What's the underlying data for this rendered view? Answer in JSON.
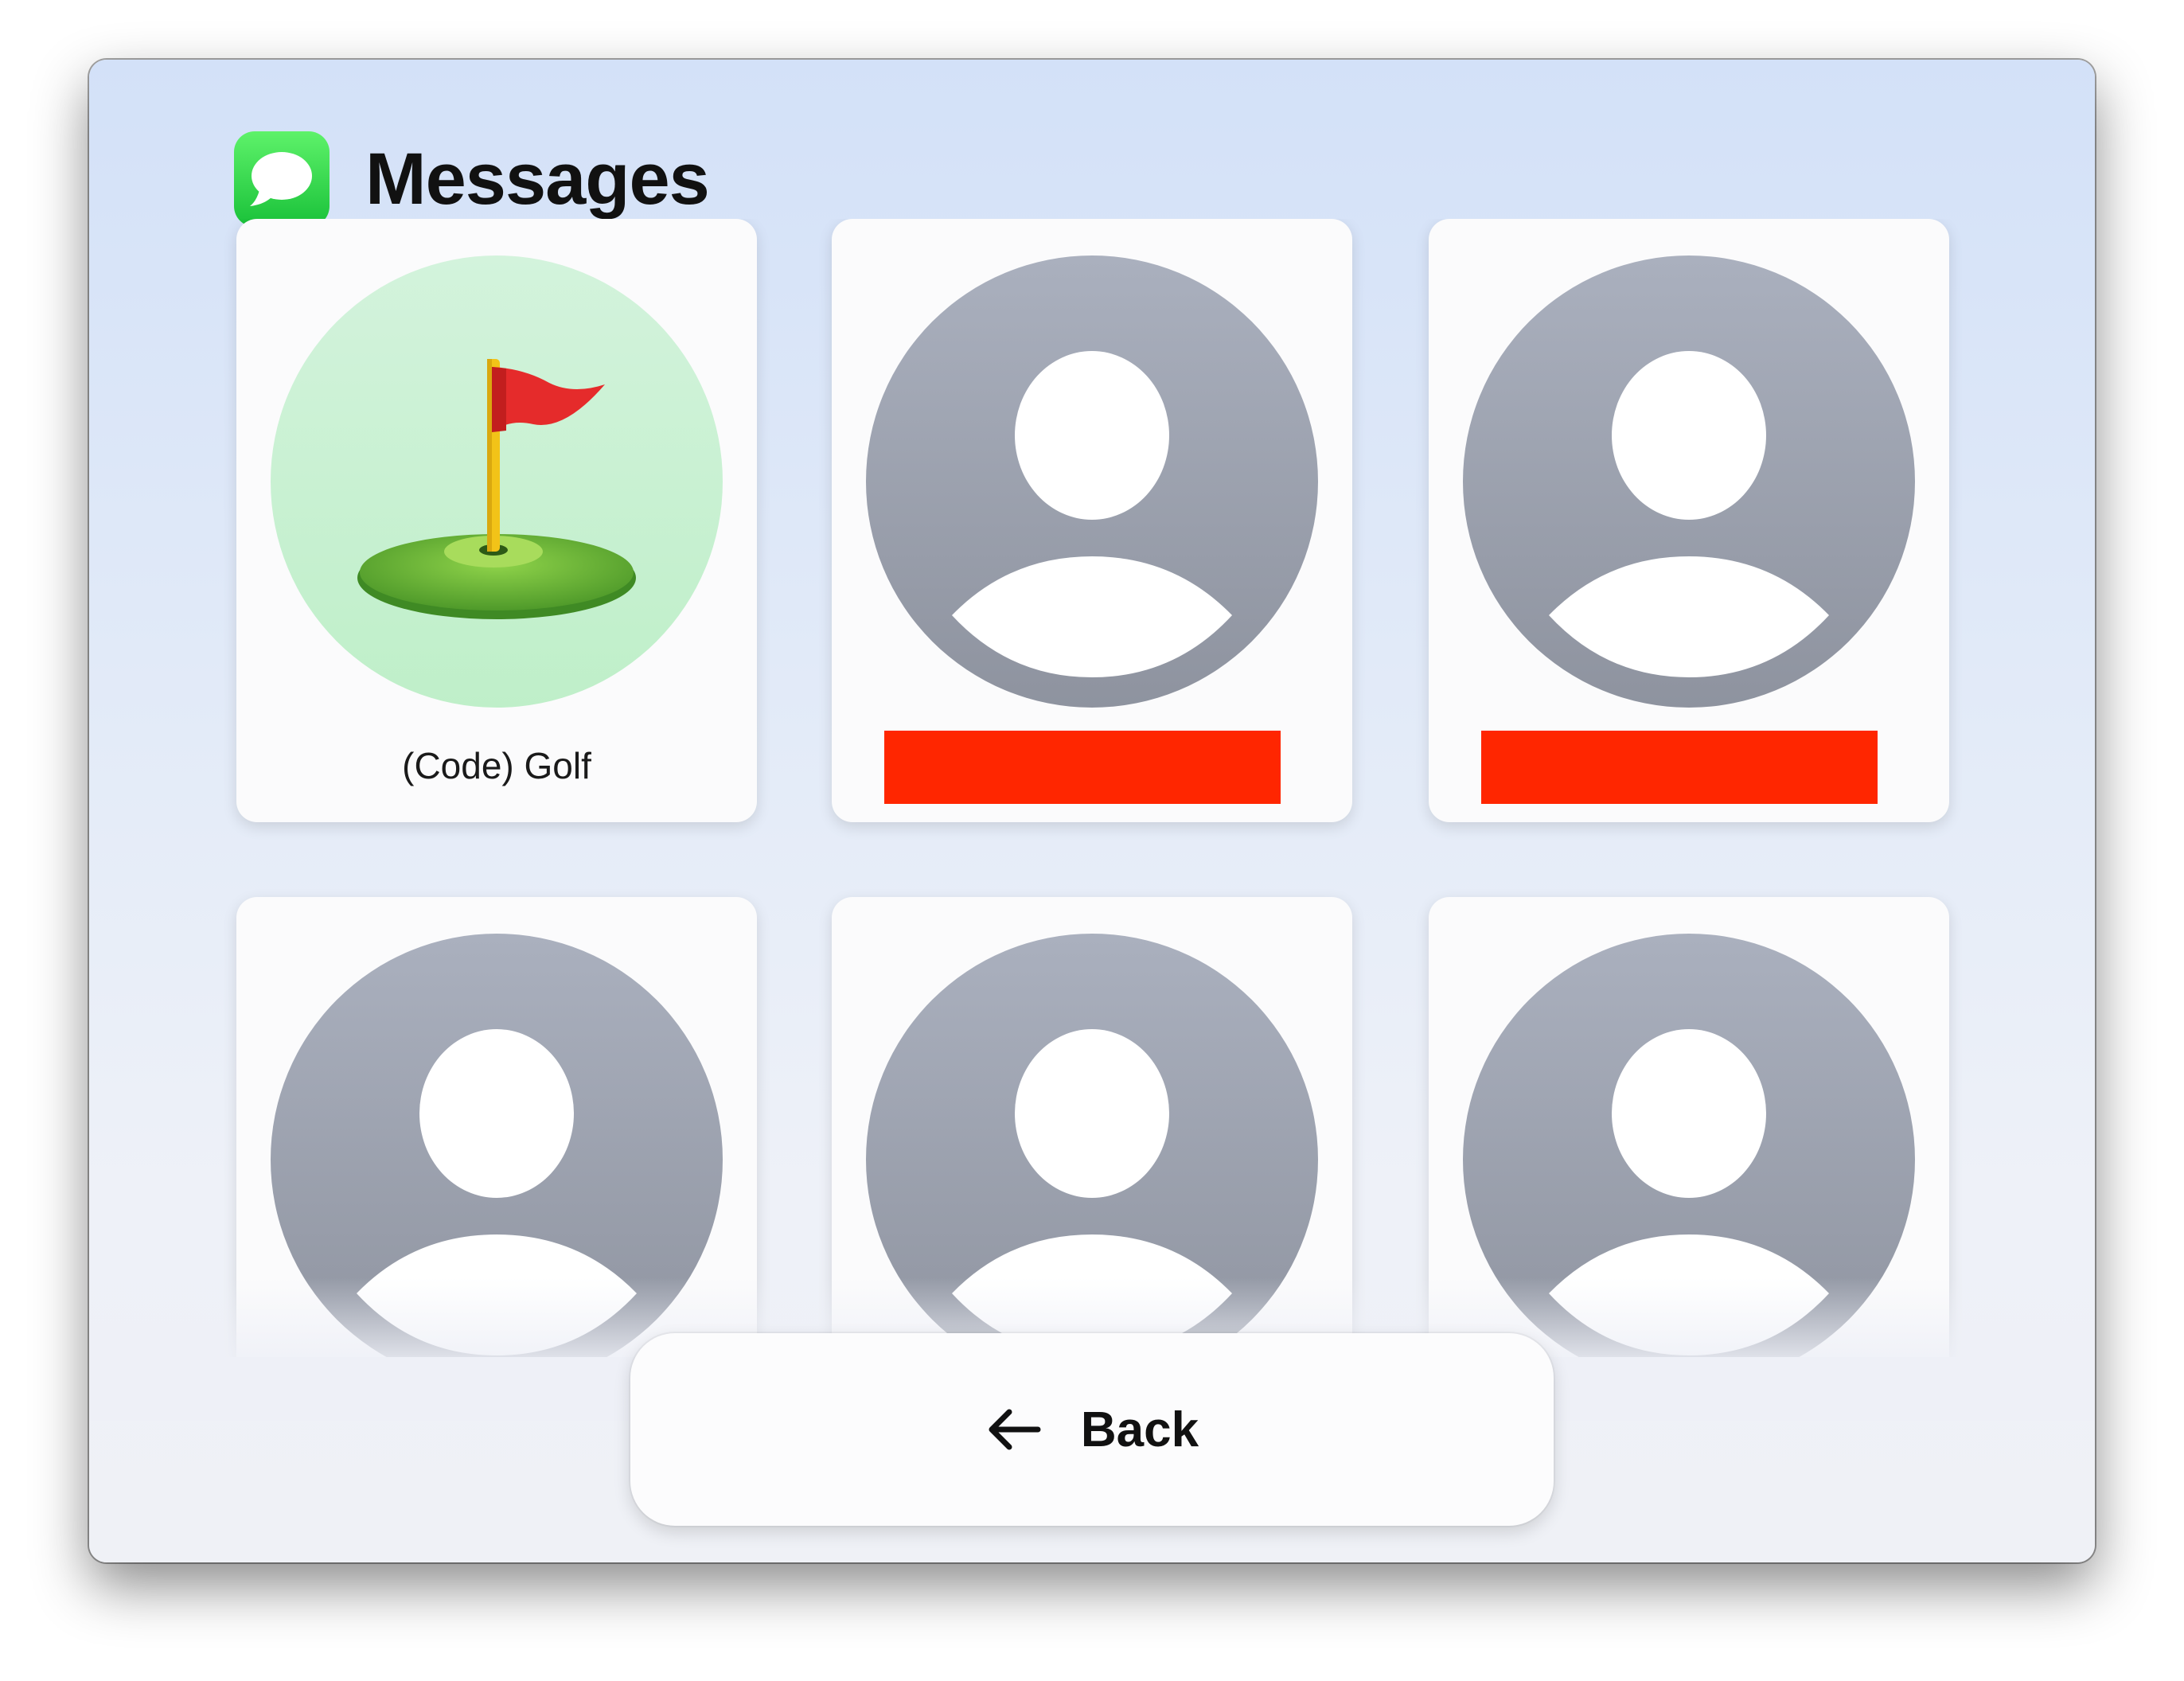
{
  "app": {
    "title": "Messages",
    "icon": "messages-app-icon",
    "accent_color": "#27c93f"
  },
  "contacts": [
    {
      "label": "(Code) Golf",
      "avatar": "golf-flag-emoji",
      "label_redacted": false
    },
    {
      "label": "",
      "avatar": "person-placeholder",
      "label_redacted": true
    },
    {
      "label": "",
      "avatar": "person-placeholder",
      "label_redacted": true
    },
    {
      "label": "",
      "avatar": "person-placeholder",
      "label_redacted": false
    },
    {
      "label": "",
      "avatar": "person-placeholder",
      "label_redacted": false
    },
    {
      "label": "",
      "avatar": "person-placeholder",
      "label_redacted": false
    }
  ],
  "redaction_color": "#ff2600",
  "back_button": {
    "label": "Back",
    "icon": "arrow-left-icon"
  }
}
